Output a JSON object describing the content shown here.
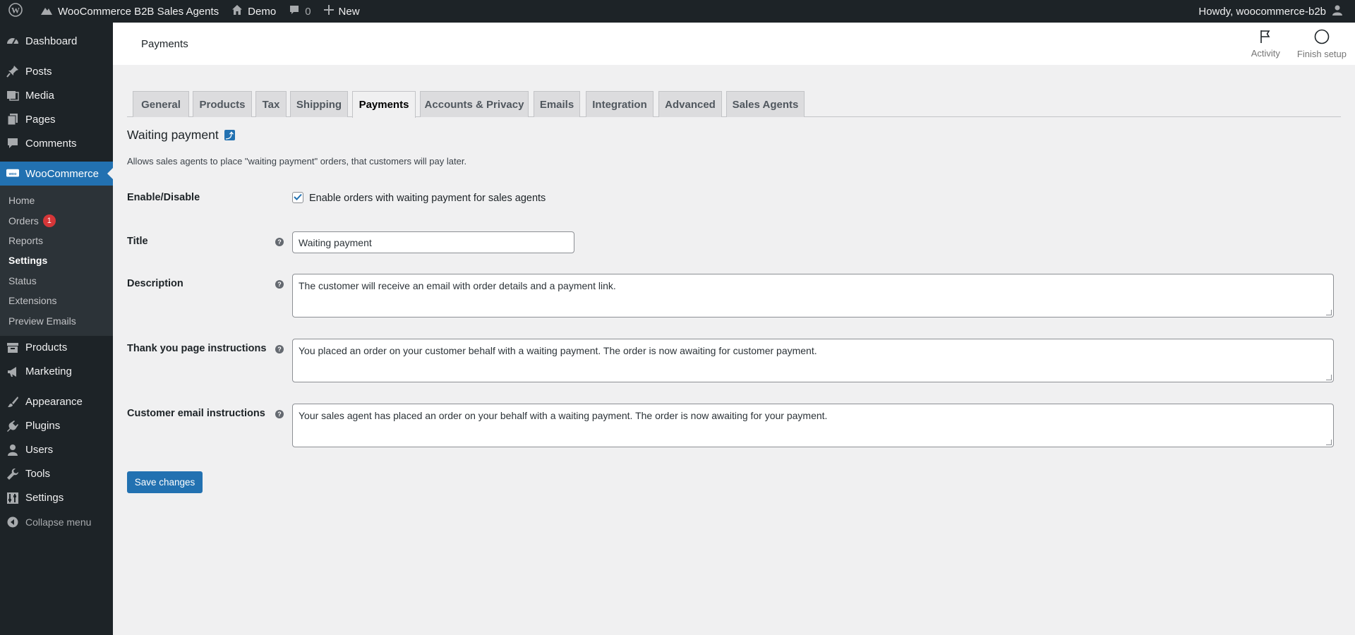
{
  "adminbar": {
    "site_name": "WooCommerce B2B Sales Agents",
    "home": "Demo",
    "comments_count": "0",
    "new_label": "New",
    "howdy": "Howdy, woocommerce-b2b"
  },
  "sidebar": {
    "dashboard": "Dashboard",
    "posts": "Posts",
    "media": "Media",
    "pages": "Pages",
    "comments": "Comments",
    "woocommerce": "WooCommerce",
    "sub": {
      "home": "Home",
      "orders": "Orders",
      "orders_badge": "1",
      "reports": "Reports",
      "settings": "Settings",
      "status": "Status",
      "extensions": "Extensions",
      "preview_emails": "Preview Emails"
    },
    "products": "Products",
    "marketing": "Marketing",
    "appearance": "Appearance",
    "plugins": "Plugins",
    "users": "Users",
    "tools": "Tools",
    "settings": "Settings",
    "collapse": "Collapse menu"
  },
  "header": {
    "title": "Payments",
    "activity": "Activity",
    "finish_setup": "Finish setup"
  },
  "tabs": [
    "General",
    "Products",
    "Tax",
    "Shipping",
    "Payments",
    "Accounts & Privacy",
    "Emails",
    "Integration",
    "Advanced",
    "Sales Agents"
  ],
  "active_tab": "Payments",
  "section": {
    "title": "Waiting payment",
    "link_icon_glyph": "⤴",
    "description": "Allows sales agents to place \"waiting payment\" orders, that customers will pay later."
  },
  "form": {
    "enable_label": "Enable/Disable",
    "enable_checkbox_label": "Enable orders with waiting payment for sales agents",
    "enable_checked": true,
    "title_label": "Title",
    "title_value": "Waiting payment",
    "description_label": "Description",
    "description_value": "The customer will receive an email with order details and a payment link.",
    "thankyou_label": "Thank you page instructions",
    "thankyou_value": "You placed an order on your customer behalf with a waiting payment. The order is now awaiting for customer payment.",
    "email_label": "Customer email instructions",
    "email_value": "Your sales agent has placed an order on your behalf with a waiting payment. The order is now awaiting for your payment.",
    "help_glyph": "?",
    "save_label": "Save changes"
  },
  "colors": {
    "admin_dark": "#1d2327",
    "accent_blue": "#2271b1",
    "badge_red": "#d63638",
    "background": "#f0f0f1"
  }
}
